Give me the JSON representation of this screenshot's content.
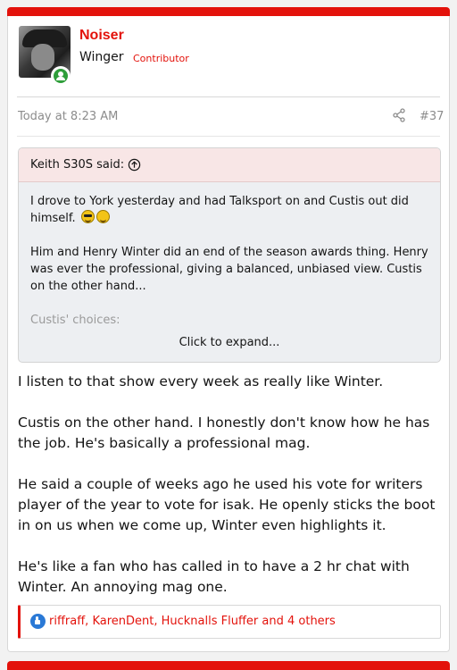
{
  "user": {
    "name": "Noiser",
    "title": "Winger",
    "banner": "Contributor"
  },
  "post": {
    "date": "Today at 8:23 AM",
    "number": "#37"
  },
  "quote": {
    "author": "Keith S30S said:",
    "paragraph1": "I drove to York yesterday and had Talksport on and Custis out did himself.",
    "paragraph2": "Him and Henry Winter did an end of the season awards thing. Henry was ever the professional, giving a balanced, unbiased view. Custis on the other hand...",
    "faded": "Custis' choices:",
    "expand_label": "Click to expand..."
  },
  "message": {
    "p1": "I listen to that show every week as really like Winter.",
    "p2": "Custis on the other hand. I honestly don't know how he has the job. He's basically a professional mag.",
    "p3": "He said a couple of weeks ago he used his vote for writers player of the year to vote for isak. He openly sticks the boot in on us when we come up, Winter even highlights it.",
    "p4": "He's like a fan who has called in to have a 2 hr chat with Winter. An annoying mag one."
  },
  "reactions": {
    "text": "riffraff, KarenDent, Hucknalls Fluffer and 4 others",
    "icon": "like-icon"
  },
  "colors": {
    "accent": "#e3120b",
    "like": "#2a79d6",
    "online": "#2e9e3a"
  }
}
